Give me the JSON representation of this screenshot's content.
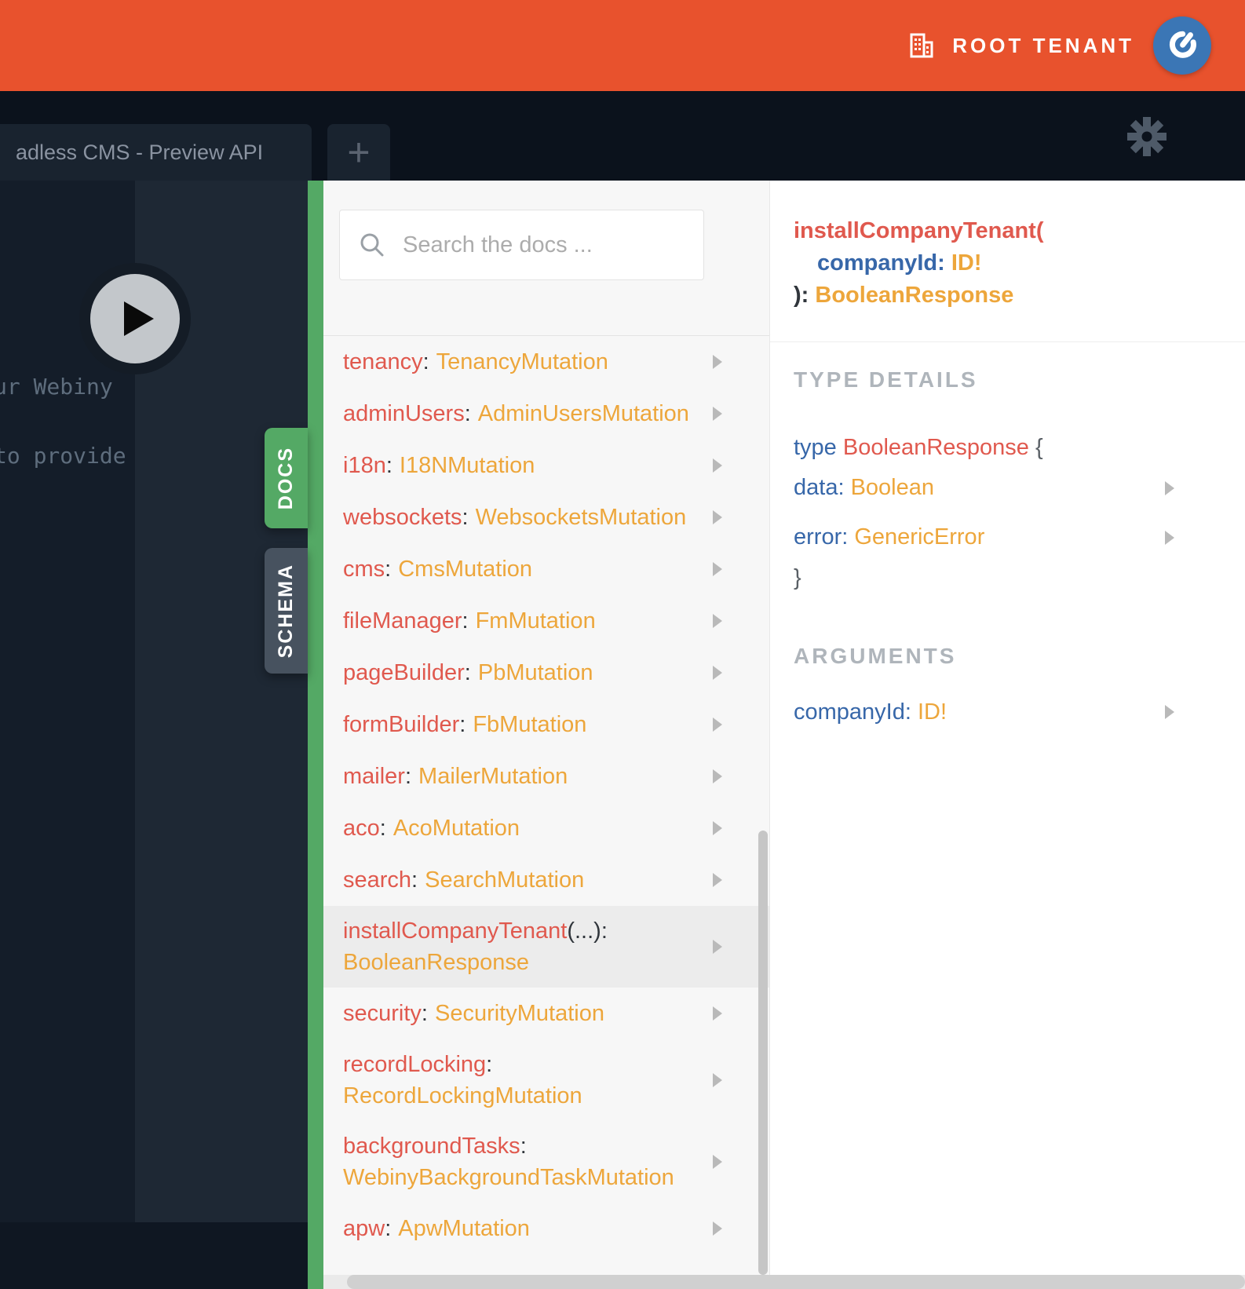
{
  "colors": {
    "header_orange": "#E8522D",
    "accent_green": "#54A965",
    "field_red": "#E0594E",
    "type_orange": "#EDA63B",
    "arg_blue": "#3767A9",
    "schema_tab_slate": "#47525F",
    "avatar_blue": "#3B76B5",
    "editor_dark": "#141D29",
    "highlight_row": "#ECECEC"
  },
  "header": {
    "tenant_label": "ROOT TENANT"
  },
  "tabbar": {
    "tab_title": "adless CMS - Preview API",
    "new_tab_label": "+"
  },
  "editor": {
    "comment_line_1": "ur Webiny",
    "comment_line_2": "to provide"
  },
  "side_tabs": {
    "docs_label": "DOCS",
    "schema_label": "SCHEMA"
  },
  "docs_panel": {
    "search_placeholder": "Search the docs ...",
    "items": [
      {
        "field": "tenancy",
        "punct": ":",
        "type": "TenancyMutation",
        "highlighted": false,
        "two_line": false
      },
      {
        "field": "adminUsers",
        "punct": ":",
        "type": "AdminUsersMutation",
        "highlighted": false,
        "two_line": false
      },
      {
        "field": "i18n",
        "punct": ":",
        "type": "I18NMutation",
        "highlighted": false,
        "two_line": false
      },
      {
        "field": "websockets",
        "punct": ":",
        "type": "WebsocketsMutation",
        "highlighted": false,
        "two_line": false
      },
      {
        "field": "cms",
        "punct": ":",
        "type": "CmsMutation",
        "highlighted": false,
        "two_line": false
      },
      {
        "field": "fileManager",
        "punct": ":",
        "type": "FmMutation",
        "highlighted": false,
        "two_line": false
      },
      {
        "field": "pageBuilder",
        "punct": ":",
        "type": "PbMutation",
        "highlighted": false,
        "two_line": false
      },
      {
        "field": "formBuilder",
        "punct": ":",
        "type": "FbMutation",
        "highlighted": false,
        "two_line": false
      },
      {
        "field": "mailer",
        "punct": ":",
        "type": "MailerMutation",
        "highlighted": false,
        "two_line": false
      },
      {
        "field": "aco",
        "punct": ":",
        "type": "AcoMutation",
        "highlighted": false,
        "two_line": false
      },
      {
        "field": "search",
        "punct": ":",
        "type": "SearchMutation",
        "highlighted": false,
        "two_line": false
      },
      {
        "field": "installCompanyTenant",
        "punct": "(...):",
        "type": "BooleanResponse",
        "highlighted": true,
        "two_line": true
      },
      {
        "field": "security",
        "punct": ":",
        "type": "SecurityMutation",
        "highlighted": false,
        "two_line": false
      },
      {
        "field": "recordLocking",
        "punct": ":",
        "type": "RecordLockingMutation",
        "highlighted": false,
        "two_line": true
      },
      {
        "field": "backgroundTasks",
        "punct": ":",
        "type": "WebinyBackgroundTaskMutation",
        "highlighted": false,
        "two_line": true
      },
      {
        "field": "apw",
        "punct": ":",
        "type": "ApwMutation",
        "highlighted": false,
        "two_line": false
      }
    ]
  },
  "detail_panel": {
    "signature": {
      "name": "installCompanyTenant(",
      "arg_name": "companyId:",
      "arg_type": "ID!",
      "closing": "):",
      "return_type": "BooleanResponse"
    },
    "type_details": {
      "heading": "TYPE DETAILS",
      "keyword": "type",
      "type_name": "BooleanResponse",
      "open_brace": "{",
      "fields": [
        {
          "name": "data:",
          "type": "Boolean"
        },
        {
          "name": "error:",
          "type": "GenericError"
        }
      ],
      "close_brace": "}"
    },
    "arguments": {
      "heading": "ARGUMENTS",
      "items": [
        {
          "name": "companyId:",
          "type": "ID!"
        }
      ]
    }
  }
}
